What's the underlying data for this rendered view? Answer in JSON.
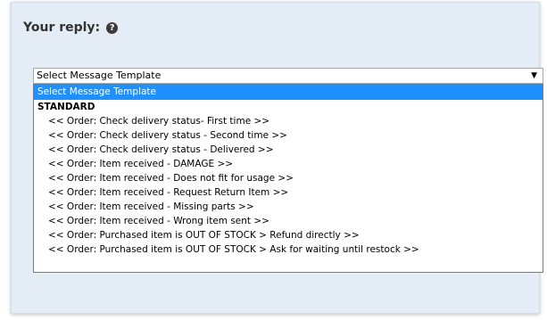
{
  "reply": {
    "label": "Your reply:",
    "help_icon": "question-circle-icon"
  },
  "template_select": {
    "value": "Select Message Template",
    "arrow": "▼",
    "options": {
      "placeholder": "Select Message Template",
      "group_label": "STANDARD",
      "items": [
        "<< Order: Check delivery status- First time >>",
        "<< Order: Check delivery status - Second time >>",
        "<< Order: Check delivery status - Delivered >>",
        "<< Order: Item received - DAMAGE >>",
        "<< Order: Item received - Does not fit for usage >>",
        "<< Order: Item received - Request Return Item >>",
        "<< Order: Item received - Missing parts >>",
        "<< Order: Item received - Wrong item sent >>",
        "<< Order: Purchased item is OUT OF STOCK > Refund directly >>",
        "<< Order: Purchased item is OUT OF STOCK > Ask for waiting until restock >>"
      ]
    }
  },
  "colors": {
    "panel_bg": "#e4ecf5",
    "selection": "#1e90ff"
  }
}
